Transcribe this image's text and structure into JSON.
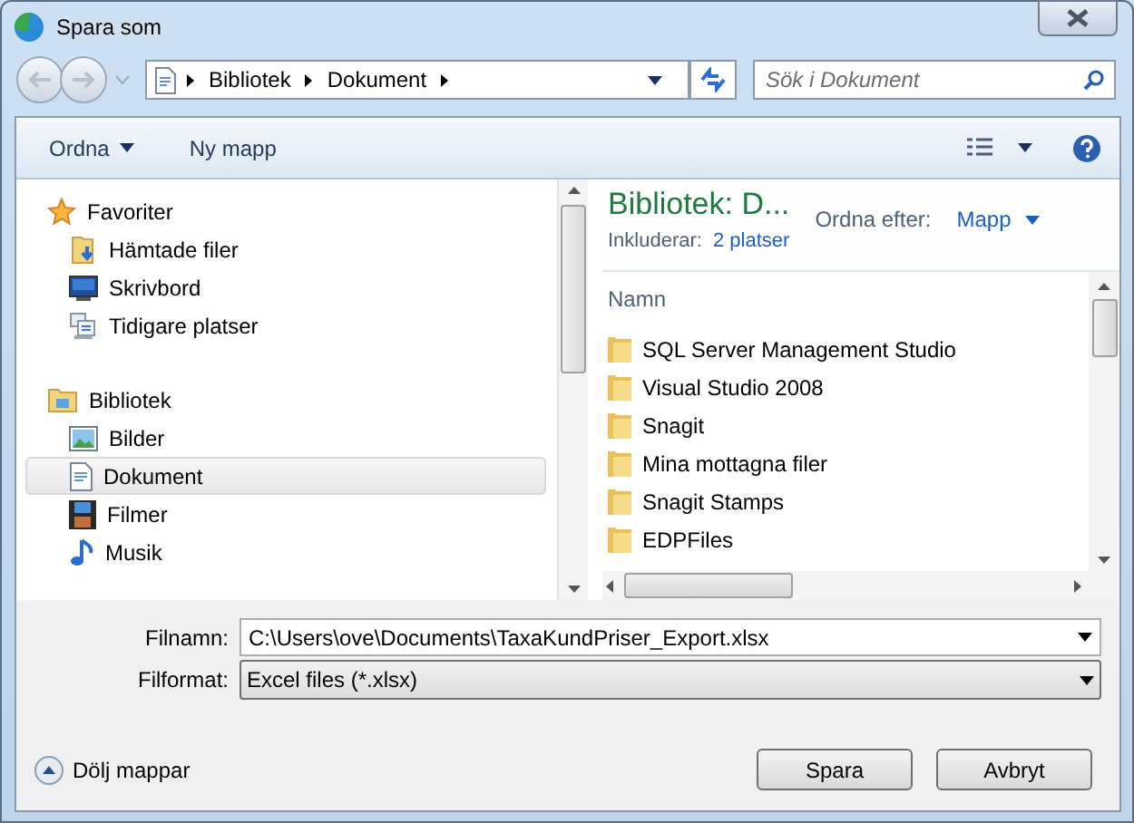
{
  "window": {
    "title": "Spara som"
  },
  "address": {
    "segments": [
      "Bibliotek",
      "Dokument"
    ]
  },
  "search": {
    "placeholder": "Sök i Dokument"
  },
  "toolbar": {
    "buttons": [
      "Ordna",
      "Ny mapp"
    ]
  },
  "nav_pane": {
    "groups": [
      {
        "label": "Favoriter",
        "items": [
          {
            "label": "Hämtade filer",
            "selected": false
          },
          {
            "label": "Skrivbord",
            "selected": false
          },
          {
            "label": "Tidigare platser",
            "selected": false
          }
        ]
      },
      {
        "label": "Bibliotek",
        "items": [
          {
            "label": "Bilder",
            "selected": false
          },
          {
            "label": "Dokument",
            "selected": true
          },
          {
            "label": "Filmer",
            "selected": false
          },
          {
            "label": "Musik",
            "selected": false
          }
        ]
      }
    ]
  },
  "library_header": {
    "title": "Bibliotek: D...",
    "includes_label": "Inkluderar:",
    "includes_link": "2 platser",
    "sort_label": "Ordna efter:",
    "sort_value": "Mapp"
  },
  "file_list": {
    "column": "Namn",
    "items": [
      "SQL Server Management Studio",
      "Visual Studio 2008",
      "Snagit",
      "Mina mottagna filer",
      "Snagit Stamps",
      "EDPFiles"
    ]
  },
  "filename": {
    "label": "Filnamn:",
    "value": "C:\\Users\\ove\\Documents\\TaxaKundPriser_Export.xlsx"
  },
  "format": {
    "label": "Filformat:",
    "value": "Excel files (*.xlsx)"
  },
  "hide_folders": "Dölj mappar",
  "buttons": [
    "Spara",
    "Avbryt"
  ]
}
